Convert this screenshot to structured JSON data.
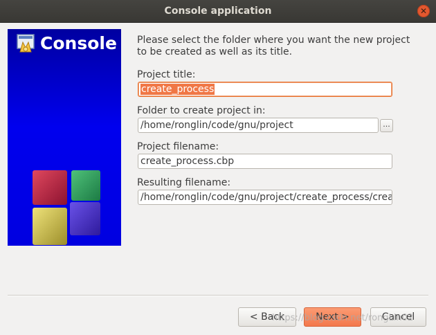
{
  "window": {
    "title": "Console application"
  },
  "banner": {
    "title": "Console"
  },
  "intro": {
    "line1": "Please select the folder where you want the new project",
    "line2": "to be created as well as its title."
  },
  "form": {
    "project_title_label": "Project title:",
    "project_title_value": "create_process",
    "folder_label": "Folder to create project in:",
    "folder_value": "/home/ronglin/code/gnu/project",
    "browse_label": "...",
    "filename_label": "Project filename:",
    "filename_value": "create_process.cbp",
    "result_label": "Resulting filename:",
    "result_value": "/home/ronglin/code/gnu/project/create_process/crea"
  },
  "buttons": {
    "back": "< Back",
    "next": "Next >",
    "cancel": "Cancel"
  },
  "watermark": "https://blog.csdn.net/rongLin02",
  "colors": {
    "accent": "#f07746",
    "banner_blue": "#0000ee",
    "titlebar": "#3f3e3a"
  }
}
